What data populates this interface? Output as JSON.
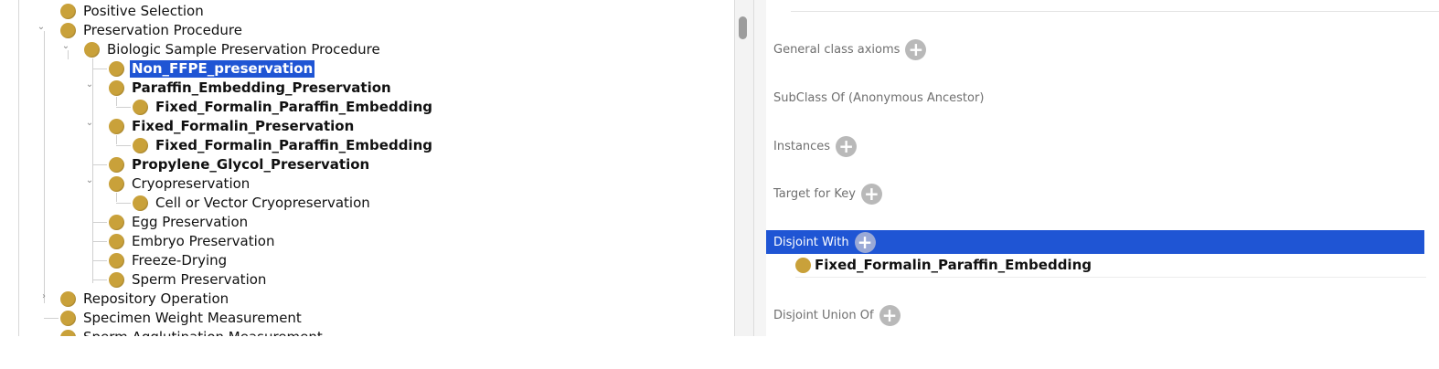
{
  "tree": {
    "nodes": [
      {
        "label": "Positive Selection"
      },
      {
        "label": "Preservation Procedure"
      },
      {
        "label": "Biologic Sample Preservation Procedure"
      },
      {
        "label": "Non_FFPE_preservation"
      },
      {
        "label": "Paraffin_Embedding_Preservation"
      },
      {
        "label": "Fixed_Formalin_Paraffin_Embedding"
      },
      {
        "label": "Fixed_Formalin_Preservation"
      },
      {
        "label": "Fixed_Formalin_Paraffin_Embedding"
      },
      {
        "label": "Propylene_Glycol_Preservation"
      },
      {
        "label": "Cryopreservation"
      },
      {
        "label": "Cell or Vector Cryopreservation"
      },
      {
        "label": "Egg Preservation"
      },
      {
        "label": "Embryo Preservation"
      },
      {
        "label": "Freeze-Drying"
      },
      {
        "label": "Sperm Preservation"
      },
      {
        "label": "Repository Operation"
      },
      {
        "label": "Specimen Weight Measurement"
      },
      {
        "label": "Sperm Agglutination Measurement"
      }
    ],
    "twisty_expanded": "⌄",
    "twisty_collapsed": "›",
    "node_color": "#c9a13a",
    "selection_color": "#1f55d4"
  },
  "description": {
    "sections": [
      {
        "label": "General class axioms"
      },
      {
        "label": "SubClass Of (Anonymous Ancestor)"
      },
      {
        "label": "Instances"
      },
      {
        "label": "Target for Key"
      },
      {
        "label": "Disjoint With"
      },
      {
        "label": "Disjoint Union Of"
      }
    ],
    "add_glyph": "+",
    "disjoint_with_entry": "Fixed_Formalin_Paraffin_Embedding"
  }
}
